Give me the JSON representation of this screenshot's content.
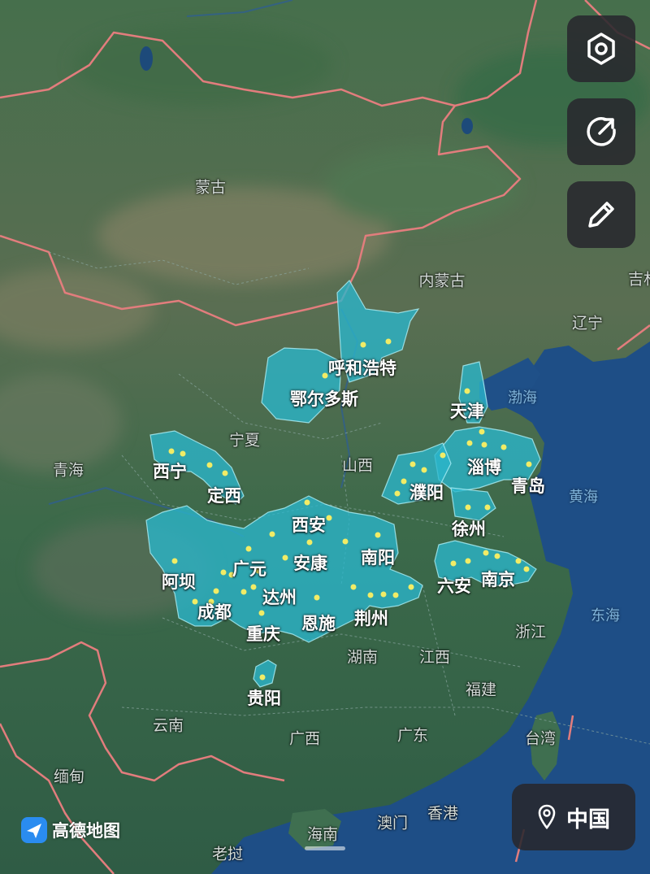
{
  "map": {
    "colors": {
      "land": "#3f6a4d",
      "water": "#1f4f86",
      "highlight": "#2fb8cf",
      "border": "#e27d7d",
      "city_dot": "#f1ec66"
    },
    "base_labels": [
      {
        "id": "mongolia",
        "text": "蒙古"
      },
      {
        "id": "inner-mongolia",
        "text": "内蒙古"
      },
      {
        "id": "jilin",
        "text": "吉林"
      },
      {
        "id": "liaoning",
        "text": "辽宁"
      },
      {
        "id": "ningxia",
        "text": "宁夏"
      },
      {
        "id": "qinghai",
        "text": "青海"
      },
      {
        "id": "shanxi",
        "text": "山西"
      },
      {
        "id": "zhejiang",
        "text": "浙江"
      },
      {
        "id": "hunan",
        "text": "湖南"
      },
      {
        "id": "jiangxi",
        "text": "江西"
      },
      {
        "id": "fujian",
        "text": "福建"
      },
      {
        "id": "yunnan",
        "text": "云南"
      },
      {
        "id": "guangxi",
        "text": "广西"
      },
      {
        "id": "guangdong",
        "text": "广东"
      },
      {
        "id": "taiwan",
        "text": "台湾"
      },
      {
        "id": "myanmar",
        "text": "缅甸"
      },
      {
        "id": "macau",
        "text": "澳门"
      },
      {
        "id": "hongkong",
        "text": "香港"
      },
      {
        "id": "hainan",
        "text": "海南"
      },
      {
        "id": "laos",
        "text": "老挝"
      }
    ],
    "sea_labels": [
      {
        "id": "bohai",
        "text": "渤海"
      },
      {
        "id": "yellow-sea",
        "text": "黄海"
      },
      {
        "id": "east-sea",
        "text": "东海"
      }
    ],
    "city_labels": [
      {
        "id": "hohhot",
        "text": "呼和浩特"
      },
      {
        "id": "ordos",
        "text": "鄂尔多斯"
      },
      {
        "id": "tianjin",
        "text": "天津"
      },
      {
        "id": "zibo",
        "text": "淄博"
      },
      {
        "id": "qingdao",
        "text": "青岛"
      },
      {
        "id": "xining",
        "text": "西宁"
      },
      {
        "id": "dingxi",
        "text": "定西"
      },
      {
        "id": "puyang",
        "text": "濮阳"
      },
      {
        "id": "xian",
        "text": "西安"
      },
      {
        "id": "xuzhou",
        "text": "徐州"
      },
      {
        "id": "nanyang",
        "text": "南阳"
      },
      {
        "id": "guangyuan",
        "text": "广元"
      },
      {
        "id": "ankang",
        "text": "安康"
      },
      {
        "id": "aba",
        "text": "阿坝"
      },
      {
        "id": "luan",
        "text": "六安"
      },
      {
        "id": "nanjing",
        "text": "南京"
      },
      {
        "id": "dazhou",
        "text": "达州"
      },
      {
        "id": "chengdu",
        "text": "成都"
      },
      {
        "id": "enshi",
        "text": "恩施"
      },
      {
        "id": "jingzhou",
        "text": "荆州"
      },
      {
        "id": "chongqing",
        "text": "重庆"
      },
      {
        "id": "guiyang",
        "text": "贵阳"
      }
    ]
  },
  "controls": {
    "layers_icon": "hexagon-settings",
    "share_icon": "share-arrow",
    "edit_icon": "pencil",
    "location_icon": "location-pin",
    "location_label": "中国"
  },
  "brand": {
    "logo_text": "高德地图",
    "logo_color": "#2a8cf0"
  }
}
